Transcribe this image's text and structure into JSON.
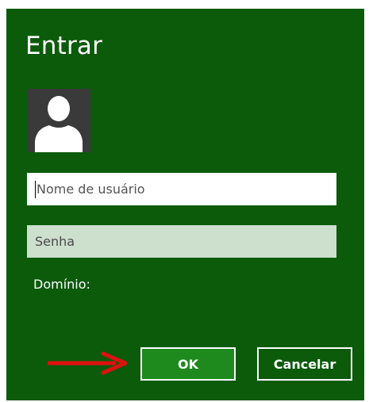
{
  "dialog": {
    "title": "Entrar",
    "avatar_icon": "user-silhouette-icon",
    "username": {
      "value": "",
      "placeholder": "Nome de usuário"
    },
    "password": {
      "value": "",
      "placeholder": "Senha"
    },
    "domain_label": "Domínio:",
    "ok_label": "OK",
    "cancel_label": "Cancelar",
    "annotation_icon": "red-arrow-icon"
  },
  "colors": {
    "background": "#0b5b0b",
    "ok_button": "#1e8a1e",
    "password_field": "#cddfcd",
    "avatar_background": "#3a3a3a",
    "arrow": "#e01010"
  }
}
